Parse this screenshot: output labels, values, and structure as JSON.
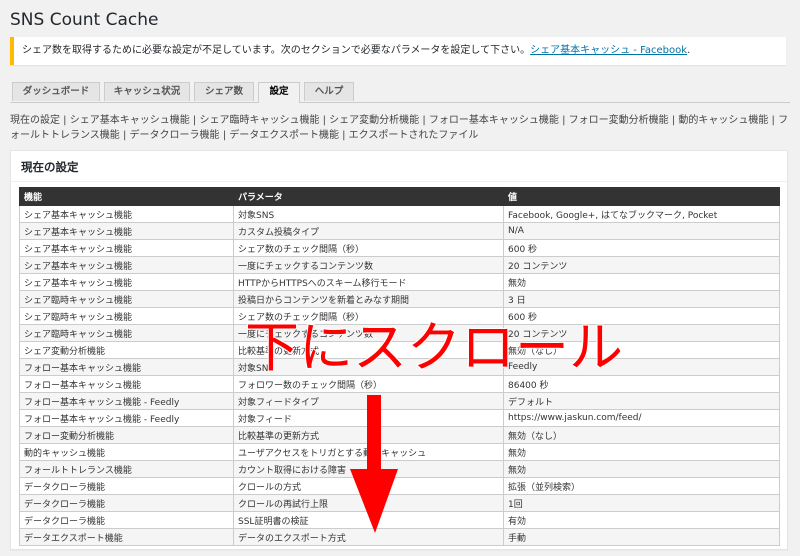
{
  "page": {
    "title": "SNS Count Cache"
  },
  "notice": {
    "text": "シェア数を取得するために必要な設定が不足しています。次のセクションで必要なパラメータを設定して下さい。",
    "link": "シェア基本キャッシュ - Facebook",
    "suffix": "."
  },
  "tabs": [
    {
      "label": "ダッシュボード"
    },
    {
      "label": "キャッシュ状況"
    },
    {
      "label": "シェア数"
    },
    {
      "label": "設定"
    },
    {
      "label": "ヘルプ"
    }
  ],
  "section_links": "現在の設定 | シェア基本キャッシュ機能 | シェア臨時キャッシュ機能 | シェア変動分析機能 | フォロー基本キャッシュ機能 | フォロー変動分析機能 | 動的キャッシュ機能 | フォールトトレランス機能 | データクローラ機能 | データエクスポート機能 | エクスポートされたファイル",
  "panel": {
    "title": "現在の設定"
  },
  "table": {
    "headers": [
      "機能",
      "パラメータ",
      "値"
    ],
    "rows": [
      [
        "シェア基本キャッシュ機能",
        "対象SNS",
        "Facebook, Google+, はてなブックマーク, Pocket"
      ],
      [
        "シェア基本キャッシュ機能",
        "カスタム投稿タイプ",
        "N/A"
      ],
      [
        "シェア基本キャッシュ機能",
        "シェア数のチェック間隔（秒）",
        "600 秒"
      ],
      [
        "シェア基本キャッシュ機能",
        "一度にチェックするコンテンツ数",
        "20 コンテンツ"
      ],
      [
        "シェア基本キャッシュ機能",
        "HTTPからHTTPSへのスキーム移行モード",
        "無効"
      ],
      [
        "シェア臨時キャッシュ機能",
        "投稿日からコンテンツを新着とみなす期間",
        "3 日"
      ],
      [
        "シェア臨時キャッシュ機能",
        "シェア数のチェック間隔（秒）",
        "600 秒"
      ],
      [
        "シェア臨時キャッシュ機能",
        "一度にチェックするコンテンツ数",
        "20 コンテンツ"
      ],
      [
        "シェア変動分析機能",
        "比較基準の更新方式",
        "無効（なし）"
      ],
      [
        "フォロー基本キャッシュ機能",
        "対象SNS",
        "Feedly"
      ],
      [
        "フォロー基本キャッシュ機能",
        "フォロワー数のチェック間隔（秒）",
        "86400 秒"
      ],
      [
        "フォロー基本キャッシュ機能 - Feedly",
        "対象フィードタイプ",
        "デフォルト"
      ],
      [
        "フォロー基本キャッシュ機能 - Feedly",
        "対象フィード",
        "https://www.jaskun.com/feed/"
      ],
      [
        "フォロー変動分析機能",
        "比較基準の更新方式",
        "無効（なし）"
      ],
      [
        "動的キャッシュ機能",
        "ユーザアクセスをトリガとする動的キャッシュ",
        "無効"
      ],
      [
        "フォールトトレランス機能",
        "カウント取得における障害",
        "無効"
      ],
      [
        "データクローラ機能",
        "クロールの方式",
        "拡張（並列検索）"
      ],
      [
        "データクローラ機能",
        "クロールの再試行上限",
        "1回"
      ],
      [
        "データクローラ機能",
        "SSL証明書の検証",
        "有効"
      ],
      [
        "データエクスポート機能",
        "データのエクスポート方式",
        "手動"
      ]
    ]
  },
  "overlay": {
    "text": "下にスクロール",
    "color": "#ff0000"
  },
  "colors": {
    "notice_border": "#ffb900",
    "link": "#0073aa",
    "table_header": "#333333"
  }
}
